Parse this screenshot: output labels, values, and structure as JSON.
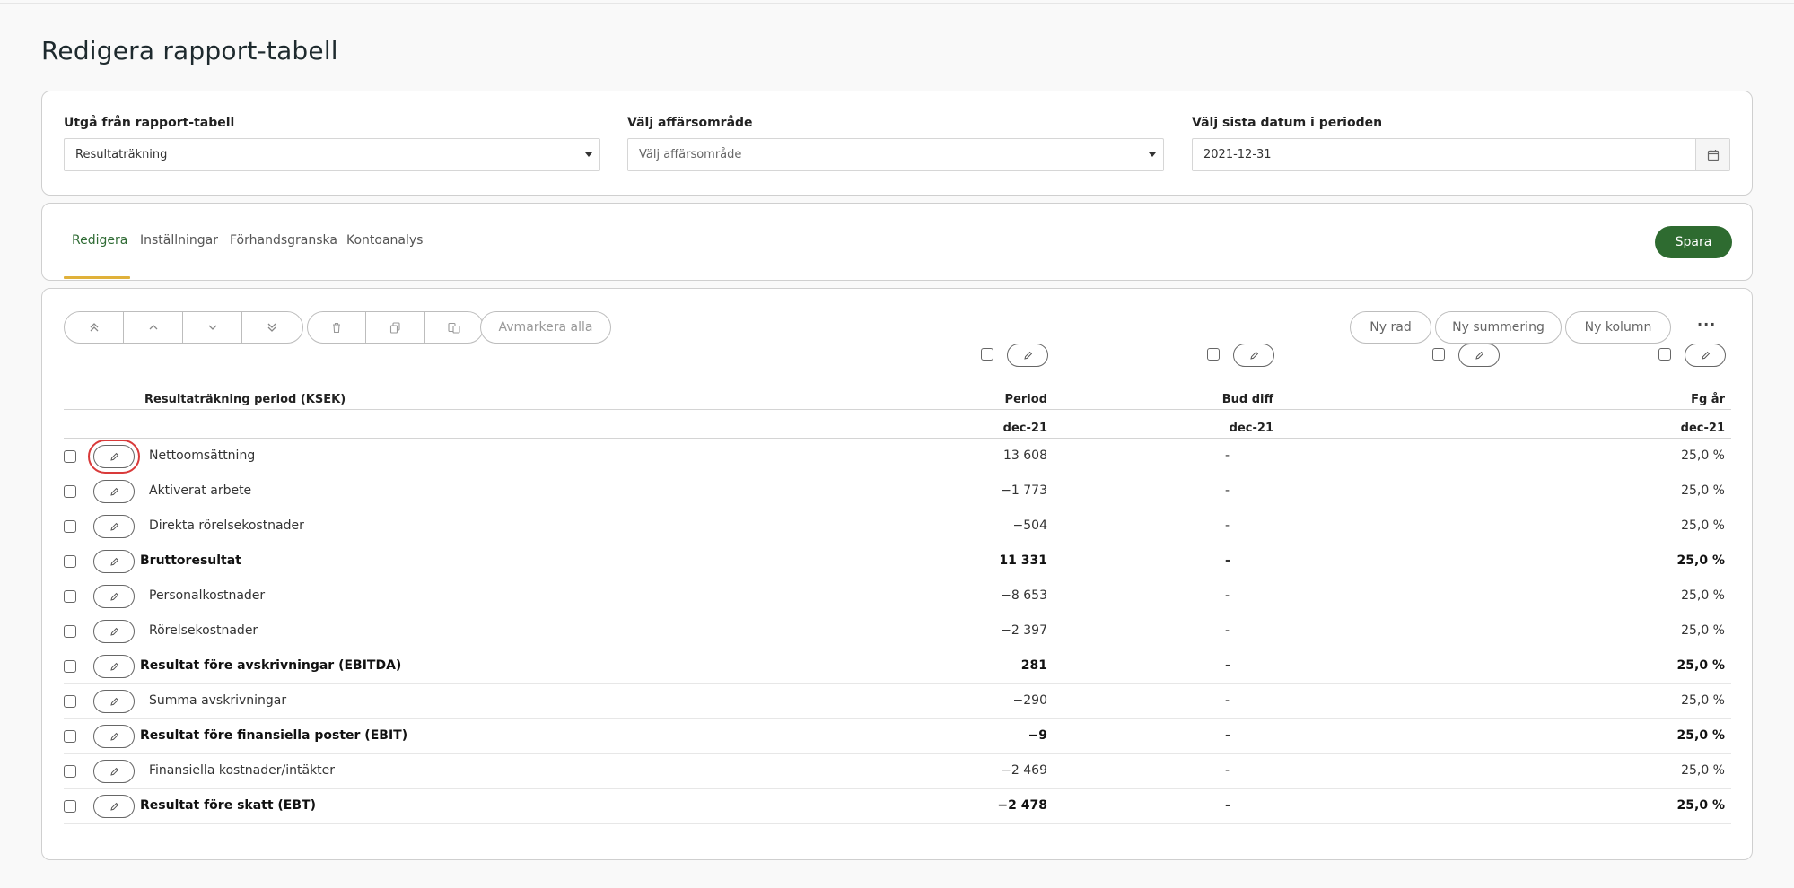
{
  "page_title": "Redigera rapport-tabell",
  "filters": {
    "source_table": {
      "label": "Utgå från rapport-tabell",
      "value": "Resultaträkning"
    },
    "business_area": {
      "label": "Välj affärsområde",
      "placeholder": "Välj affärsområde"
    },
    "end_date": {
      "label": "Välj sista datum i perioden",
      "value": "2021-12-31"
    }
  },
  "tabs": [
    {
      "label": "Redigera",
      "active": true
    },
    {
      "label": "Inställningar",
      "active": false
    },
    {
      "label": "Förhandsgranska",
      "active": false
    },
    {
      "label": "Kontoanalys",
      "active": false
    }
  ],
  "save_label": "Spara",
  "toolbar": {
    "move_buttons": [
      "chevrons-up-icon",
      "chevron-up-icon",
      "chevron-down-icon",
      "chevrons-down-icon"
    ],
    "action_buttons": [
      "trash-icon",
      "copy-icon",
      "paste-icon"
    ],
    "deselect_all": "Avmarkera alla",
    "new_row": "Ny rad",
    "new_sum": "Ny summering",
    "new_column": "Ny kolumn",
    "more": "···"
  },
  "table": {
    "row_header": "Resultaträkning period (KSEK)",
    "columns": [
      {
        "name": "Period",
        "sub": "dec-21"
      },
      {
        "name": "Bud diff",
        "sub": "dec-21"
      },
      {
        "name": "Fg år",
        "sub": "dec-21"
      }
    ],
    "rows": [
      {
        "label": "Nettoomsättning",
        "bold": false,
        "period": "13 608",
        "bud_diff": "-",
        "fg_ar": "25,0 %"
      },
      {
        "label": "Aktiverat arbete",
        "bold": false,
        "period": "−1 773",
        "bud_diff": "-",
        "fg_ar": "25,0 %"
      },
      {
        "label": "Direkta rörelsekostnader",
        "bold": false,
        "period": "−504",
        "bud_diff": "-",
        "fg_ar": "25,0 %"
      },
      {
        "label": "Bruttoresultat",
        "bold": true,
        "period": "11 331",
        "bud_diff": "-",
        "fg_ar": "25,0 %"
      },
      {
        "label": "Personalkostnader",
        "bold": false,
        "period": "−8 653",
        "bud_diff": "-",
        "fg_ar": "25,0 %"
      },
      {
        "label": "Rörelsekostnader",
        "bold": false,
        "period": "−2 397",
        "bud_diff": "-",
        "fg_ar": "25,0 %"
      },
      {
        "label": "Resultat före avskrivningar (EBITDA)",
        "bold": true,
        "period": "281",
        "bud_diff": "-",
        "fg_ar": "25,0 %"
      },
      {
        "label": "Summa avskrivningar",
        "bold": false,
        "period": "−290",
        "bud_diff": "-",
        "fg_ar": "25,0 %"
      },
      {
        "label": "Resultat före finansiella poster (EBIT)",
        "bold": true,
        "period": "−9",
        "bud_diff": "-",
        "fg_ar": "25,0 %"
      },
      {
        "label": "Finansiella kostnader/intäkter",
        "bold": false,
        "period": "−2 469",
        "bud_diff": "-",
        "fg_ar": "25,0 %"
      },
      {
        "label": "Resultat före skatt (EBT)",
        "bold": true,
        "period": "−2 478",
        "bud_diff": "-",
        "fg_ar": "25,0 %"
      }
    ]
  },
  "colors": {
    "accent": "#2e6b30",
    "tab_underline": "#e0b13a",
    "highlight": "#d93a3a"
  }
}
